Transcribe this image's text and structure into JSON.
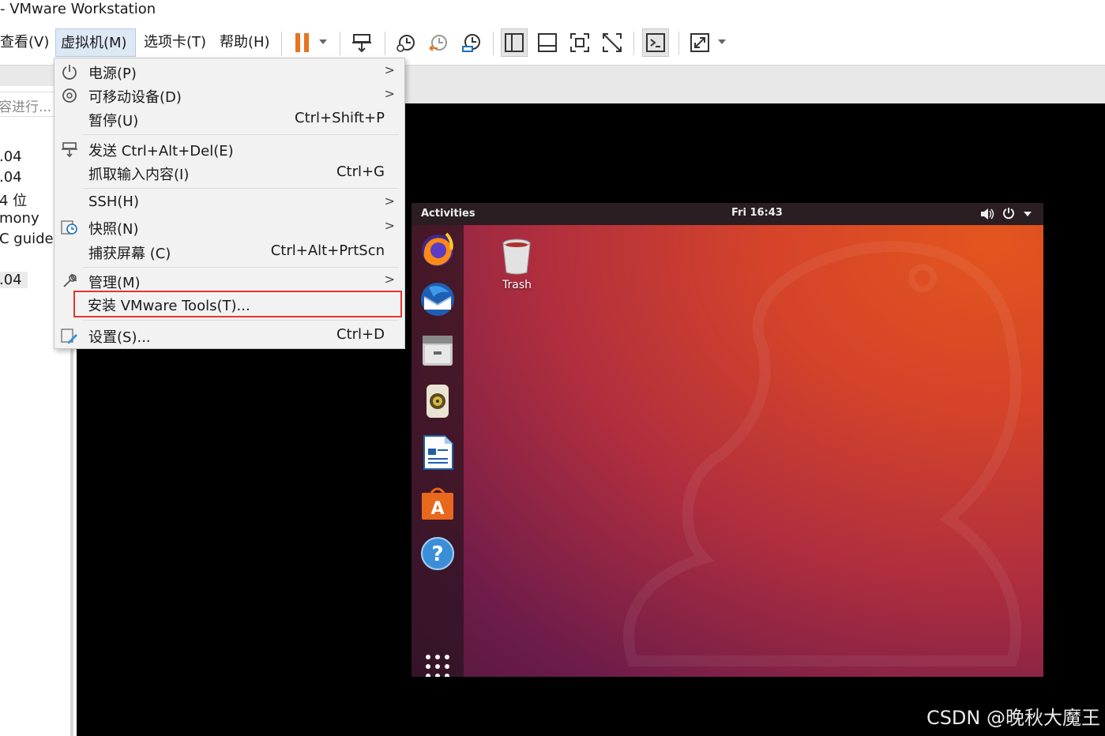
{
  "window": {
    "title": "- VMware Workstation"
  },
  "menubar": {
    "items": [
      {
        "label": "查看(V)"
      },
      {
        "label": "虚拟机(M)"
      },
      {
        "label": "选项卡(T)"
      },
      {
        "label": "帮助(H)"
      }
    ]
  },
  "toolbar": {
    "buttons": [
      "pause-icon",
      "send-ctrl-alt-del-icon",
      "snapshot-icon",
      "revert-snapshot-icon",
      "snapshot-manager-icon",
      "show-library-icon",
      "thumbnail-bar-icon",
      "full-screen-icon",
      "unity-icon",
      "console-view-icon",
      "stretch-guest-icon"
    ]
  },
  "library": {
    "search_placeholder": "容进行...",
    "rows": [
      ".04",
      ".04",
      "4 位",
      "mony",
      "C guide",
      ".04"
    ]
  },
  "vm_menu": {
    "items": [
      {
        "label": "电源(P)",
        "shortcut": "",
        "submenu": true,
        "icon": "power-icon"
      },
      {
        "label": "可移动设备(D)",
        "shortcut": "",
        "submenu": true,
        "icon": "removable-device-icon"
      },
      {
        "label": "暂停(U)",
        "shortcut": "Ctrl+Shift+P",
        "submenu": false,
        "icon": ""
      },
      {
        "label": "发送 Ctrl+Alt+Del(E)",
        "shortcut": "",
        "submenu": false,
        "icon": "send-keys-icon"
      },
      {
        "label": "抓取输入内容(I)",
        "shortcut": "Ctrl+G",
        "submenu": false,
        "icon": ""
      },
      {
        "label": "SSH(H)",
        "shortcut": "",
        "submenu": true,
        "icon": ""
      },
      {
        "label": "快照(N)",
        "shortcut": "",
        "submenu": true,
        "icon": "snapshot-icon"
      },
      {
        "label": "捕获屏幕 (C)",
        "shortcut": "Ctrl+Alt+PrtScn",
        "submenu": false,
        "icon": ""
      },
      {
        "label": "管理(M)",
        "shortcut": "",
        "submenu": true,
        "icon": "wrench-icon"
      },
      {
        "label": "安装 VMware Tools(T)...",
        "shortcut": "",
        "submenu": false,
        "icon": ""
      },
      {
        "label": "设置(S)...",
        "shortcut": "Ctrl+D",
        "submenu": false,
        "icon": "settings-icon"
      }
    ]
  },
  "guest": {
    "topbar": {
      "activities": "Activities",
      "clock": "Fri 16:43"
    },
    "desktop": {
      "trash_label": "Trash"
    },
    "dock": [
      "firefox-icon",
      "thunderbird-icon",
      "files-icon",
      "rhythmbox-icon",
      "libreoffice-writer-icon",
      "software-center-icon",
      "help-icon",
      "show-apps-icon"
    ]
  },
  "watermark": "CSDN @晚秋大魔王",
  "colors": {
    "highlight_border": "#e0362e",
    "pause_orange": "#e8741e",
    "ubuntu_orange": "#e4551e"
  }
}
